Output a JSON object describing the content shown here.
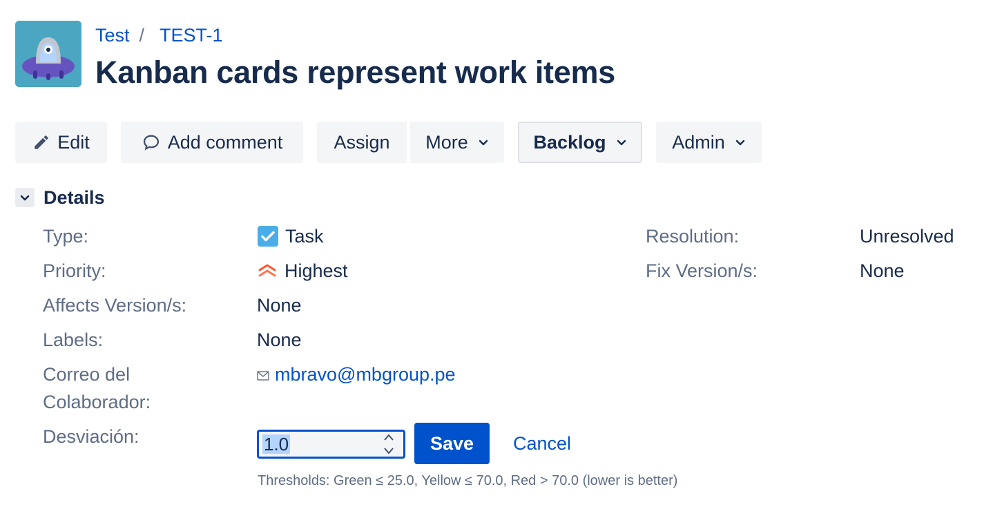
{
  "project": {
    "avatar_icon": "alien-ufo-avatar-icon"
  },
  "breadcrumb": {
    "project": "Test",
    "separator": "/",
    "issue_key": "TEST-1"
  },
  "issue": {
    "title": "Kanban cards represent work items"
  },
  "toolbar": {
    "edit": "Edit",
    "add_comment": "Add comment",
    "assign": "Assign",
    "more": "More",
    "status": "Backlog",
    "admin": "Admin"
  },
  "details": {
    "heading": "Details",
    "type_label": "Type:",
    "type_value": "Task",
    "priority_label": "Priority:",
    "priority_value": "Highest",
    "affects_label": "Affects Version/s:",
    "affects_value": "None",
    "labels_label": "Labels:",
    "labels_value": "None",
    "email_label_1": "Correo del",
    "email_label_2": "Colaborador:",
    "email_value": "mbravo@mbgroup.pe",
    "deviation_label": "Desviación:",
    "deviation_value": "1.0",
    "resolution_label": "Resolution:",
    "resolution_value": "Unresolved",
    "fix_label": "Fix Version/s:",
    "fix_value": "None"
  },
  "edit_form": {
    "save": "Save",
    "cancel": "Cancel",
    "thresholds": "Thresholds: Green ≤ 25.0, Yellow ≤ 70.0, Red > 70.0 (lower is better)"
  },
  "colors": {
    "link": "#0052cc",
    "primary_button": "#0052cc",
    "priority_highest": "#ff5630",
    "task_icon": "#4bade8"
  }
}
